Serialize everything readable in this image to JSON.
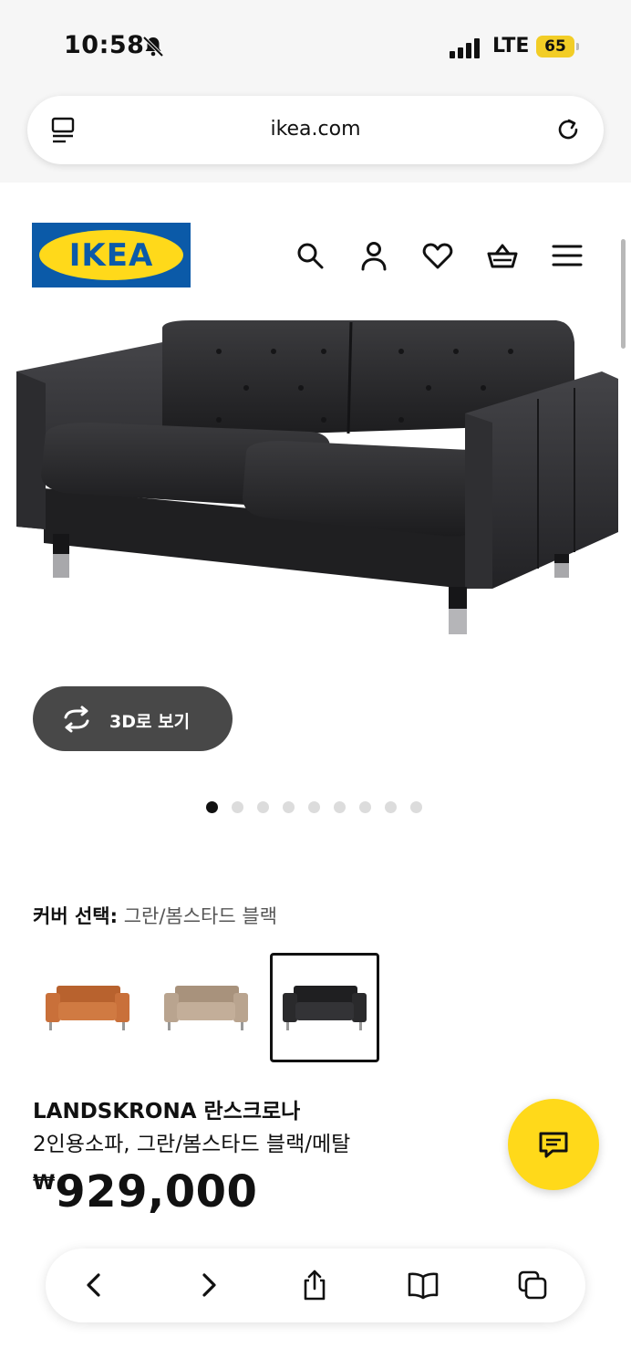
{
  "status_bar": {
    "time": "10:58",
    "network": "LTE",
    "battery": "65"
  },
  "browser": {
    "url": "ikea.com"
  },
  "brand": {
    "logo_text": "IKEA",
    "blue": "#0b5aa8",
    "yellow": "#ffd91a"
  },
  "header_icons": [
    "search-icon",
    "account-icon",
    "heart-icon",
    "cart-icon",
    "menu-icon"
  ],
  "gallery": {
    "view_3d_label": "3D로 보기",
    "image_count": 9,
    "active_index": 0
  },
  "cover": {
    "label": "커버 선택:",
    "selected": "그란/봄스타드 블랙",
    "swatches": [
      {
        "name": "orange-leather",
        "color": "#c9703a",
        "selected": false
      },
      {
        "name": "beige-leather",
        "color": "#b9a48f",
        "selected": false
      },
      {
        "name": "black-leather",
        "color": "#2a2a2c",
        "selected": true
      }
    ]
  },
  "product": {
    "name": "LANDSKRONA 란스크로나",
    "description": "2인용소파, 그란/봄스타드 블랙/메탈",
    "currency": "₩",
    "price": "929,000"
  },
  "toolbar": [
    "back-icon",
    "forward-icon",
    "share-icon",
    "bookmarks-icon",
    "tabs-icon"
  ]
}
